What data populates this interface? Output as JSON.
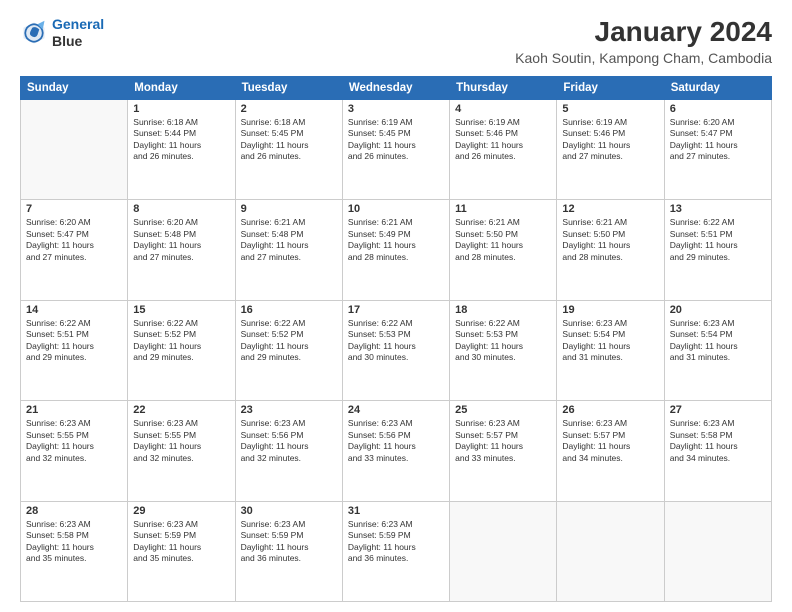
{
  "header": {
    "logo_line1": "General",
    "logo_line2": "Blue",
    "main_title": "January 2024",
    "subtitle": "Kaoh Soutin, Kampong Cham, Cambodia"
  },
  "weekdays": [
    "Sunday",
    "Monday",
    "Tuesday",
    "Wednesday",
    "Thursday",
    "Friday",
    "Saturday"
  ],
  "weeks": [
    [
      {
        "day": "",
        "text": ""
      },
      {
        "day": "1",
        "text": "Sunrise: 6:18 AM\nSunset: 5:44 PM\nDaylight: 11 hours\nand 26 minutes."
      },
      {
        "day": "2",
        "text": "Sunrise: 6:18 AM\nSunset: 5:45 PM\nDaylight: 11 hours\nand 26 minutes."
      },
      {
        "day": "3",
        "text": "Sunrise: 6:19 AM\nSunset: 5:45 PM\nDaylight: 11 hours\nand 26 minutes."
      },
      {
        "day": "4",
        "text": "Sunrise: 6:19 AM\nSunset: 5:46 PM\nDaylight: 11 hours\nand 26 minutes."
      },
      {
        "day": "5",
        "text": "Sunrise: 6:19 AM\nSunset: 5:46 PM\nDaylight: 11 hours\nand 27 minutes."
      },
      {
        "day": "6",
        "text": "Sunrise: 6:20 AM\nSunset: 5:47 PM\nDaylight: 11 hours\nand 27 minutes."
      }
    ],
    [
      {
        "day": "7",
        "text": "Sunrise: 6:20 AM\nSunset: 5:47 PM\nDaylight: 11 hours\nand 27 minutes."
      },
      {
        "day": "8",
        "text": "Sunrise: 6:20 AM\nSunset: 5:48 PM\nDaylight: 11 hours\nand 27 minutes."
      },
      {
        "day": "9",
        "text": "Sunrise: 6:21 AM\nSunset: 5:48 PM\nDaylight: 11 hours\nand 27 minutes."
      },
      {
        "day": "10",
        "text": "Sunrise: 6:21 AM\nSunset: 5:49 PM\nDaylight: 11 hours\nand 28 minutes."
      },
      {
        "day": "11",
        "text": "Sunrise: 6:21 AM\nSunset: 5:50 PM\nDaylight: 11 hours\nand 28 minutes."
      },
      {
        "day": "12",
        "text": "Sunrise: 6:21 AM\nSunset: 5:50 PM\nDaylight: 11 hours\nand 28 minutes."
      },
      {
        "day": "13",
        "text": "Sunrise: 6:22 AM\nSunset: 5:51 PM\nDaylight: 11 hours\nand 29 minutes."
      }
    ],
    [
      {
        "day": "14",
        "text": "Sunrise: 6:22 AM\nSunset: 5:51 PM\nDaylight: 11 hours\nand 29 minutes."
      },
      {
        "day": "15",
        "text": "Sunrise: 6:22 AM\nSunset: 5:52 PM\nDaylight: 11 hours\nand 29 minutes."
      },
      {
        "day": "16",
        "text": "Sunrise: 6:22 AM\nSunset: 5:52 PM\nDaylight: 11 hours\nand 29 minutes."
      },
      {
        "day": "17",
        "text": "Sunrise: 6:22 AM\nSunset: 5:53 PM\nDaylight: 11 hours\nand 30 minutes."
      },
      {
        "day": "18",
        "text": "Sunrise: 6:22 AM\nSunset: 5:53 PM\nDaylight: 11 hours\nand 30 minutes."
      },
      {
        "day": "19",
        "text": "Sunrise: 6:23 AM\nSunset: 5:54 PM\nDaylight: 11 hours\nand 31 minutes."
      },
      {
        "day": "20",
        "text": "Sunrise: 6:23 AM\nSunset: 5:54 PM\nDaylight: 11 hours\nand 31 minutes."
      }
    ],
    [
      {
        "day": "21",
        "text": "Sunrise: 6:23 AM\nSunset: 5:55 PM\nDaylight: 11 hours\nand 32 minutes."
      },
      {
        "day": "22",
        "text": "Sunrise: 6:23 AM\nSunset: 5:55 PM\nDaylight: 11 hours\nand 32 minutes."
      },
      {
        "day": "23",
        "text": "Sunrise: 6:23 AM\nSunset: 5:56 PM\nDaylight: 11 hours\nand 32 minutes."
      },
      {
        "day": "24",
        "text": "Sunrise: 6:23 AM\nSunset: 5:56 PM\nDaylight: 11 hours\nand 33 minutes."
      },
      {
        "day": "25",
        "text": "Sunrise: 6:23 AM\nSunset: 5:57 PM\nDaylight: 11 hours\nand 33 minutes."
      },
      {
        "day": "26",
        "text": "Sunrise: 6:23 AM\nSunset: 5:57 PM\nDaylight: 11 hours\nand 34 minutes."
      },
      {
        "day": "27",
        "text": "Sunrise: 6:23 AM\nSunset: 5:58 PM\nDaylight: 11 hours\nand 34 minutes."
      }
    ],
    [
      {
        "day": "28",
        "text": "Sunrise: 6:23 AM\nSunset: 5:58 PM\nDaylight: 11 hours\nand 35 minutes."
      },
      {
        "day": "29",
        "text": "Sunrise: 6:23 AM\nSunset: 5:59 PM\nDaylight: 11 hours\nand 35 minutes."
      },
      {
        "day": "30",
        "text": "Sunrise: 6:23 AM\nSunset: 5:59 PM\nDaylight: 11 hours\nand 36 minutes."
      },
      {
        "day": "31",
        "text": "Sunrise: 6:23 AM\nSunset: 5:59 PM\nDaylight: 11 hours\nand 36 minutes."
      },
      {
        "day": "",
        "text": ""
      },
      {
        "day": "",
        "text": ""
      },
      {
        "day": "",
        "text": ""
      }
    ]
  ]
}
